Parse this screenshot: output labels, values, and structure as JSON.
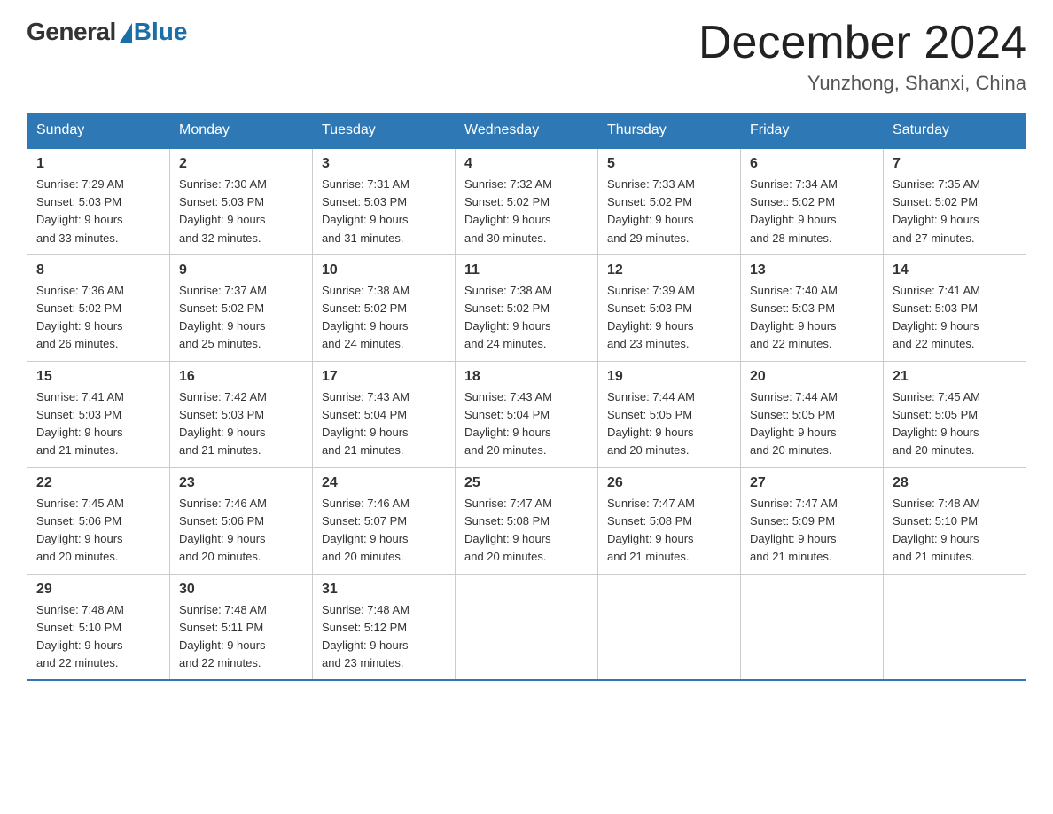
{
  "header": {
    "logo_general": "General",
    "logo_blue": "Blue",
    "month_title": "December 2024",
    "location": "Yunzhong, Shanxi, China"
  },
  "columns": [
    "Sunday",
    "Monday",
    "Tuesday",
    "Wednesday",
    "Thursday",
    "Friday",
    "Saturday"
  ],
  "weeks": [
    [
      {
        "day": "1",
        "sunrise": "7:29 AM",
        "sunset": "5:03 PM",
        "daylight": "9 hours and 33 minutes."
      },
      {
        "day": "2",
        "sunrise": "7:30 AM",
        "sunset": "5:03 PM",
        "daylight": "9 hours and 32 minutes."
      },
      {
        "day": "3",
        "sunrise": "7:31 AM",
        "sunset": "5:03 PM",
        "daylight": "9 hours and 31 minutes."
      },
      {
        "day": "4",
        "sunrise": "7:32 AM",
        "sunset": "5:02 PM",
        "daylight": "9 hours and 30 minutes."
      },
      {
        "day": "5",
        "sunrise": "7:33 AM",
        "sunset": "5:02 PM",
        "daylight": "9 hours and 29 minutes."
      },
      {
        "day": "6",
        "sunrise": "7:34 AM",
        "sunset": "5:02 PM",
        "daylight": "9 hours and 28 minutes."
      },
      {
        "day": "7",
        "sunrise": "7:35 AM",
        "sunset": "5:02 PM",
        "daylight": "9 hours and 27 minutes."
      }
    ],
    [
      {
        "day": "8",
        "sunrise": "7:36 AM",
        "sunset": "5:02 PM",
        "daylight": "9 hours and 26 minutes."
      },
      {
        "day": "9",
        "sunrise": "7:37 AM",
        "sunset": "5:02 PM",
        "daylight": "9 hours and 25 minutes."
      },
      {
        "day": "10",
        "sunrise": "7:38 AM",
        "sunset": "5:02 PM",
        "daylight": "9 hours and 24 minutes."
      },
      {
        "day": "11",
        "sunrise": "7:38 AM",
        "sunset": "5:02 PM",
        "daylight": "9 hours and 24 minutes."
      },
      {
        "day": "12",
        "sunrise": "7:39 AM",
        "sunset": "5:03 PM",
        "daylight": "9 hours and 23 minutes."
      },
      {
        "day": "13",
        "sunrise": "7:40 AM",
        "sunset": "5:03 PM",
        "daylight": "9 hours and 22 minutes."
      },
      {
        "day": "14",
        "sunrise": "7:41 AM",
        "sunset": "5:03 PM",
        "daylight": "9 hours and 22 minutes."
      }
    ],
    [
      {
        "day": "15",
        "sunrise": "7:41 AM",
        "sunset": "5:03 PM",
        "daylight": "9 hours and 21 minutes."
      },
      {
        "day": "16",
        "sunrise": "7:42 AM",
        "sunset": "5:03 PM",
        "daylight": "9 hours and 21 minutes."
      },
      {
        "day": "17",
        "sunrise": "7:43 AM",
        "sunset": "5:04 PM",
        "daylight": "9 hours and 21 minutes."
      },
      {
        "day": "18",
        "sunrise": "7:43 AM",
        "sunset": "5:04 PM",
        "daylight": "9 hours and 20 minutes."
      },
      {
        "day": "19",
        "sunrise": "7:44 AM",
        "sunset": "5:05 PM",
        "daylight": "9 hours and 20 minutes."
      },
      {
        "day": "20",
        "sunrise": "7:44 AM",
        "sunset": "5:05 PM",
        "daylight": "9 hours and 20 minutes."
      },
      {
        "day": "21",
        "sunrise": "7:45 AM",
        "sunset": "5:05 PM",
        "daylight": "9 hours and 20 minutes."
      }
    ],
    [
      {
        "day": "22",
        "sunrise": "7:45 AM",
        "sunset": "5:06 PM",
        "daylight": "9 hours and 20 minutes."
      },
      {
        "day": "23",
        "sunrise": "7:46 AM",
        "sunset": "5:06 PM",
        "daylight": "9 hours and 20 minutes."
      },
      {
        "day": "24",
        "sunrise": "7:46 AM",
        "sunset": "5:07 PM",
        "daylight": "9 hours and 20 minutes."
      },
      {
        "day": "25",
        "sunrise": "7:47 AM",
        "sunset": "5:08 PM",
        "daylight": "9 hours and 20 minutes."
      },
      {
        "day": "26",
        "sunrise": "7:47 AM",
        "sunset": "5:08 PM",
        "daylight": "9 hours and 21 minutes."
      },
      {
        "day": "27",
        "sunrise": "7:47 AM",
        "sunset": "5:09 PM",
        "daylight": "9 hours and 21 minutes."
      },
      {
        "day": "28",
        "sunrise": "7:48 AM",
        "sunset": "5:10 PM",
        "daylight": "9 hours and 21 minutes."
      }
    ],
    [
      {
        "day": "29",
        "sunrise": "7:48 AM",
        "sunset": "5:10 PM",
        "daylight": "9 hours and 22 minutes."
      },
      {
        "day": "30",
        "sunrise": "7:48 AM",
        "sunset": "5:11 PM",
        "daylight": "9 hours and 22 minutes."
      },
      {
        "day": "31",
        "sunrise": "7:48 AM",
        "sunset": "5:12 PM",
        "daylight": "9 hours and 23 minutes."
      },
      null,
      null,
      null,
      null
    ]
  ]
}
